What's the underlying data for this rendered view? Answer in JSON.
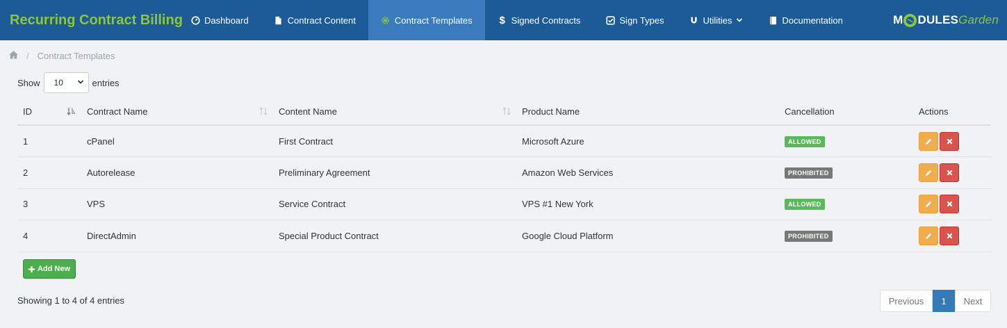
{
  "app": {
    "title": "Recurring Contract Billing"
  },
  "nav": {
    "items": [
      {
        "label": "Dashboard",
        "icon": "dashboard-icon"
      },
      {
        "label": "Contract Content",
        "icon": "file-icon"
      },
      {
        "label": "Contract Templates",
        "icon": "gear-icon"
      },
      {
        "label": "Signed Contracts",
        "icon": "dollar-icon"
      },
      {
        "label": "Sign Types",
        "icon": "check-square-icon"
      },
      {
        "label": "Utilities",
        "icon": "magnet-icon"
      },
      {
        "label": "Documentation",
        "icon": "book-icon"
      }
    ],
    "active_index": 2
  },
  "logo": {
    "part1": "M",
    "part2": "DULES",
    "part3": "Garden"
  },
  "breadcrumb": {
    "current": "Contract Templates"
  },
  "length": {
    "show": "Show",
    "value": "10",
    "entries": "entries"
  },
  "table": {
    "headers": {
      "id": "ID",
      "contract_name": "Contract Name",
      "content_name": "Content Name",
      "product_name": "Product Name",
      "cancellation": "Cancellation",
      "actions": "Actions"
    },
    "rows": [
      {
        "id": "1",
        "contract": "cPanel",
        "content": "First Contract",
        "product": "Microsoft Azure",
        "cancellation": "ALLOWED"
      },
      {
        "id": "2",
        "contract": "Autorelease",
        "content": "Preliminary Agreement",
        "product": "Amazon Web Services",
        "cancellation": "PROHIBITED"
      },
      {
        "id": "3",
        "contract": "VPS",
        "content": "Service Contract",
        "product": "VPS #1 New York",
        "cancellation": "ALLOWED"
      },
      {
        "id": "4",
        "contract": "DirectAdmin",
        "content": "Special Product Contract",
        "product": "Google Cloud Platform",
        "cancellation": "PROHIBITED"
      }
    ]
  },
  "add_button": {
    "label": "Add New"
  },
  "info": "Showing 1 to 4 of 4 entries",
  "pagination": {
    "previous": "Previous",
    "current": "1",
    "next": "Next"
  },
  "colors": {
    "navbar": "#1d5b97",
    "nav_active": "#3a7bbd",
    "brand": "#8dc63f",
    "allowed": "#5cb85c",
    "prohibited": "#777777",
    "edit": "#f0ad4e",
    "delete": "#d9534f",
    "add": "#4cae4c",
    "page_active": "#337ab7"
  }
}
